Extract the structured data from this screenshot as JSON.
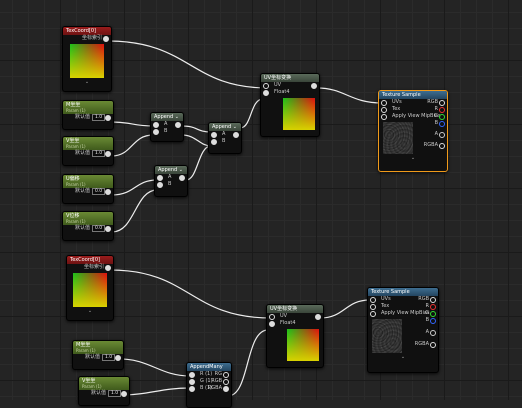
{
  "colors": {
    "selected_border": "#f09a1a",
    "wire": "#ededed"
  },
  "group1": {
    "texcoord": {
      "title": "TexCoord[0]",
      "output_label": "坐标索引"
    },
    "param1": {
      "title": "M坐坐",
      "subtitle": "Param (1)",
      "field_label": "默认值",
      "value": "1.0"
    },
    "param2": {
      "title": "V坐坐",
      "subtitle": "Param (1)",
      "field_label": "默认值",
      "value": "1.0"
    },
    "param3": {
      "title": "U偏移",
      "subtitle": "Param (1)",
      "field_label": "默认值",
      "value": "0.0"
    },
    "param4": {
      "title": "V位移",
      "subtitle": "Param (1)",
      "field_label": "默认值",
      "value": "0.0"
    },
    "append1": {
      "title": "Append",
      "pin_a": "A",
      "pin_b": "B"
    },
    "append2": {
      "title": "Append",
      "pin_a": "A",
      "pin_b": "B"
    },
    "append3": {
      "title": "Append",
      "pin_a": "A",
      "pin_b": "B"
    },
    "uv_node": {
      "title": "UV坐标变换",
      "pin_uv": "UV",
      "pin_float4": "Float4"
    },
    "texture_sample": {
      "title": "Texture Sample",
      "pins": [
        "UVs",
        "Tex",
        "Apply View MipBias"
      ],
      "outputs": [
        "RGB",
        "R",
        "G",
        "B",
        "A",
        "RGBA"
      ]
    }
  },
  "group2": {
    "texcoord": {
      "title": "TexCoord[0]",
      "output_label": "坐标索引"
    },
    "param1": {
      "title": "M坐坐",
      "subtitle": "Param (1)",
      "field_label": "默认值",
      "value": "1.0"
    },
    "param2": {
      "title": "V坐坐",
      "subtitle": "Param (1)",
      "field_label": "默认值",
      "value": "1.0"
    },
    "uv_node": {
      "title": "UV坐标变换",
      "pin_uv": "UV",
      "pin_float4": "Float4"
    },
    "append_many": {
      "title": "AppendMany",
      "rows": [
        {
          "label": "R (1)",
          "out": "RG"
        },
        {
          "label": "G (1)",
          "out": "RGB"
        },
        {
          "label": "B (1)",
          "out": "RGBA"
        }
      ]
    },
    "texture_sample": {
      "title": "Texture Sample",
      "pins": [
        "UVs",
        "Tex",
        "Apply View MipBias"
      ],
      "outputs": [
        "RGB",
        "R",
        "G",
        "B",
        "A",
        "RGBA"
      ]
    }
  }
}
